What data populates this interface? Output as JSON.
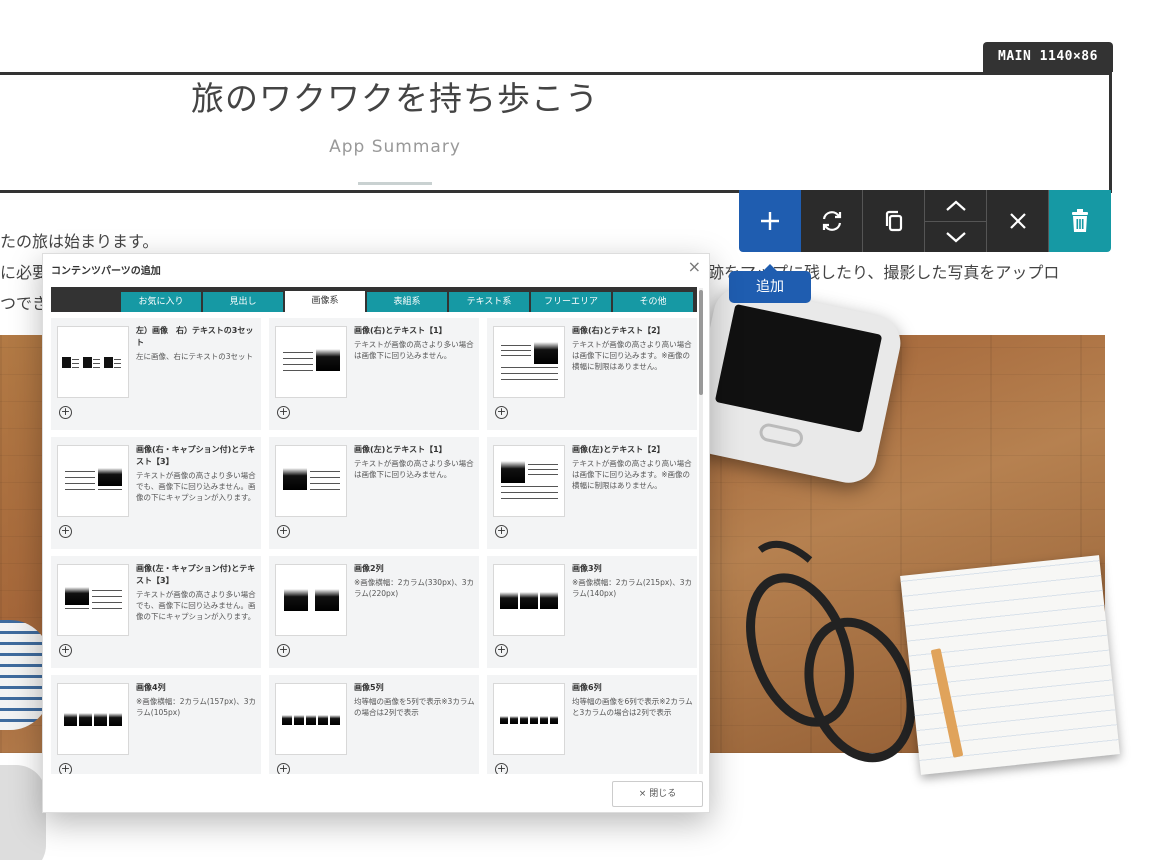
{
  "header": {
    "badge": "MAIN 1140×86",
    "title": "旅のワクワクを持ち歩こう",
    "subtitle": "App Summary"
  },
  "toolbar": {
    "tooltip": "追加",
    "buttons": [
      "plus-icon",
      "refresh-icon",
      "copy-icon",
      "arrow-up-icon",
      "arrow-down-icon",
      "close-icon",
      "trash-icon"
    ],
    "colors": {
      "add": "#1f5db0",
      "dark": "#2b2b2b",
      "delete": "#1699a4"
    }
  },
  "background_text": {
    "line1": "たの旅は始まります。",
    "line2_left": "に必要",
    "line2_right": "跡をマップに残したり、撮影した写真をアップロ",
    "line3_left": "つでき"
  },
  "modal": {
    "title": "コンテンツパーツの追加",
    "close_glyph": "×",
    "tabs": [
      "お気に入り",
      "見出し",
      "画像系",
      "表組系",
      "テキスト系",
      "フリーエリア",
      "その他"
    ],
    "active_tab": "画像系",
    "close_button": "× 閉じる",
    "cards": [
      {
        "title": "左）画像　右）テキストの3セット",
        "desc": "左に画像、右にテキストの3セット",
        "thumb": "three-set"
      },
      {
        "title": "画像(右)とテキスト【1】",
        "desc": "テキストが画像の高さより多い場合は画像下に回り込みません。",
        "thumb": "right-1"
      },
      {
        "title": "画像(右)とテキスト【2】",
        "desc": "テキストが画像の高さより高い場合は画像下に回り込みます。※画像の横幅に制限はありません。",
        "thumb": "right-2"
      },
      {
        "title": "画像(右・キャプション付)とテキスト【3】",
        "desc": "テキストが画像の高さより多い場合でも、画像下に回り込みません。画像の下にキャプションが入ります。",
        "thumb": "right-3"
      },
      {
        "title": "画像(左)とテキスト【1】",
        "desc": "テキストが画像の高さより多い場合は画像下に回り込みません。",
        "thumb": "left-1"
      },
      {
        "title": "画像(左)とテキスト【2】",
        "desc": "テキストが画像の高さより高い場合は画像下に回り込みます。※画像の横幅に制限はありません。",
        "thumb": "left-2"
      },
      {
        "title": "画像(左・キャプション付)とテキスト【3】",
        "desc": "テキストが画像の高さより多い場合でも、画像下に回り込みません。画像の下にキャプションが入ります。",
        "thumb": "left-3"
      },
      {
        "title": "画像2列",
        "desc": "※画像横幅：2カラム(330px)、3カラム(220px)",
        "thumb": "cols-2"
      },
      {
        "title": "画像3列",
        "desc": "※画像横幅：2カラム(215px)、3カラム(140px)",
        "thumb": "cols-3"
      },
      {
        "title": "画像4列",
        "desc": "※画像横幅：2カラム(157px)、3カラム(105px)",
        "thumb": "cols-4"
      },
      {
        "title": "画像5列",
        "desc": "均等幅の画像を5列で表示※3カラムの場合は2列で表示",
        "thumb": "cols-5"
      },
      {
        "title": "画像6列",
        "desc": "均等幅の画像を6列で表示※2カラムと3カラムの場合は2列で表示",
        "thumb": "cols-6"
      }
    ]
  }
}
